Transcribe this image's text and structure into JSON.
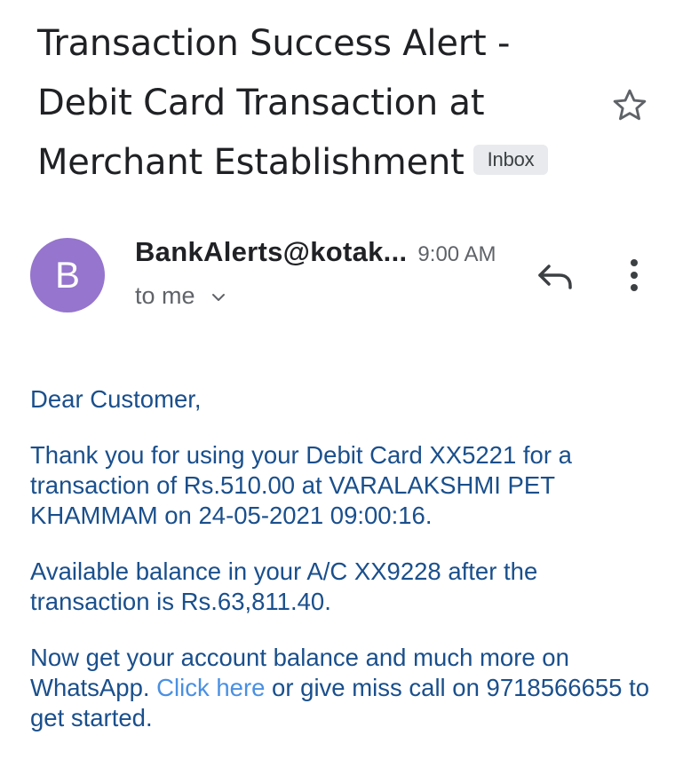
{
  "email": {
    "subject": "Transaction Success Alert - Debit Card Transaction at Merchant Establishment",
    "label_chip": "Inbox",
    "star_icon": "star-outline-icon",
    "sender": {
      "avatar_letter": "B",
      "avatar_color": "#9575cd",
      "name": "BankAlerts@kotak...",
      "time": "9:00 AM",
      "recipient": "to me"
    },
    "actions": {
      "reply_icon": "reply-icon",
      "more_icon": "more-vert-icon"
    },
    "body": {
      "greeting": "Dear Customer,",
      "paragraph1": "Thank you for using your Debit Card XX5221 for a transaction of Rs.510.00 at VARALAKSHMI PET KHAMMAM on 24-05-2021 09:00:16.",
      "paragraph2": "Available balance in your A/C XX9228 after the transaction is Rs.63,811.40.",
      "paragraph3_before_link": "Now get your account balance and much more on WhatsApp. ",
      "link_text": "Click here",
      "paragraph3_after_link": " or give miss call on 9718566655 to get started."
    }
  },
  "colors": {
    "text_primary": "#202124",
    "text_secondary": "#5f6368",
    "body_text": "#1a4f8c",
    "link": "#4a90e2",
    "chip_bg": "#e8eaed"
  }
}
